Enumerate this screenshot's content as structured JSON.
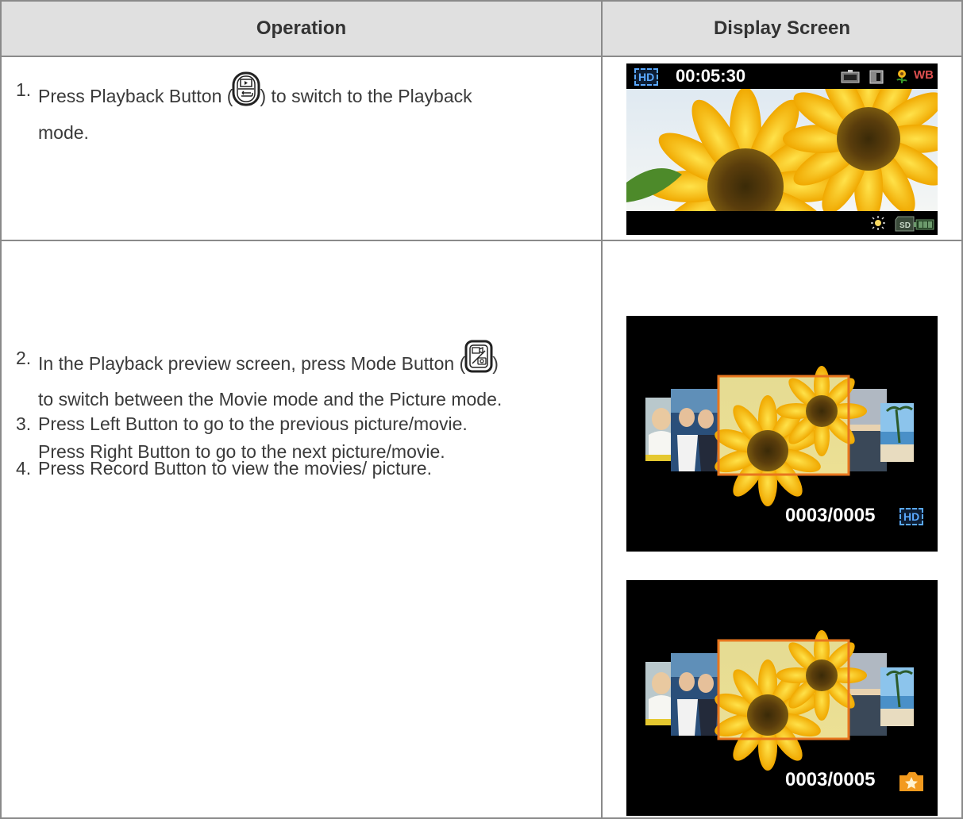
{
  "table": {
    "header_operation": "Operation",
    "header_display": "Display Screen"
  },
  "steps": [
    {
      "num": "1.",
      "line1_before": "Press Playback Button (",
      "line1_after": ") to switch to the Playback",
      "line2": "mode.",
      "icon": "playback-button-icon"
    },
    {
      "num": "2.",
      "line1_before": "In the Playback preview screen, press Mode Button (",
      "line1_after": ")",
      "line2": "to switch between the Movie mode and the Picture mode.",
      "icon": "mode-button-icon"
    },
    {
      "num": "3.",
      "line1": "Press Left Button to go to the previous picture/movie.",
      "line2": "Press Right Button to go to the next picture/movie."
    },
    {
      "num": "4.",
      "line1": "Press Record Button to view the movies/ picture."
    }
  ],
  "screens": {
    "playback": {
      "hd_badge": "HD",
      "timecode": "00:05:30",
      "wb": "WB",
      "sd": "SD"
    },
    "movie_preview": {
      "counter": "0003/0005",
      "badge": "HD"
    },
    "picture_preview": {
      "counter": "0003/0005",
      "badge_icon": "star-icon"
    }
  },
  "colors": {
    "header_bg": "#e0e0e0",
    "border": "#8a8a8a",
    "highlight_frame": "#e8761e",
    "hd_blue": "#5aa9ff",
    "wb_color": "#e05050"
  }
}
